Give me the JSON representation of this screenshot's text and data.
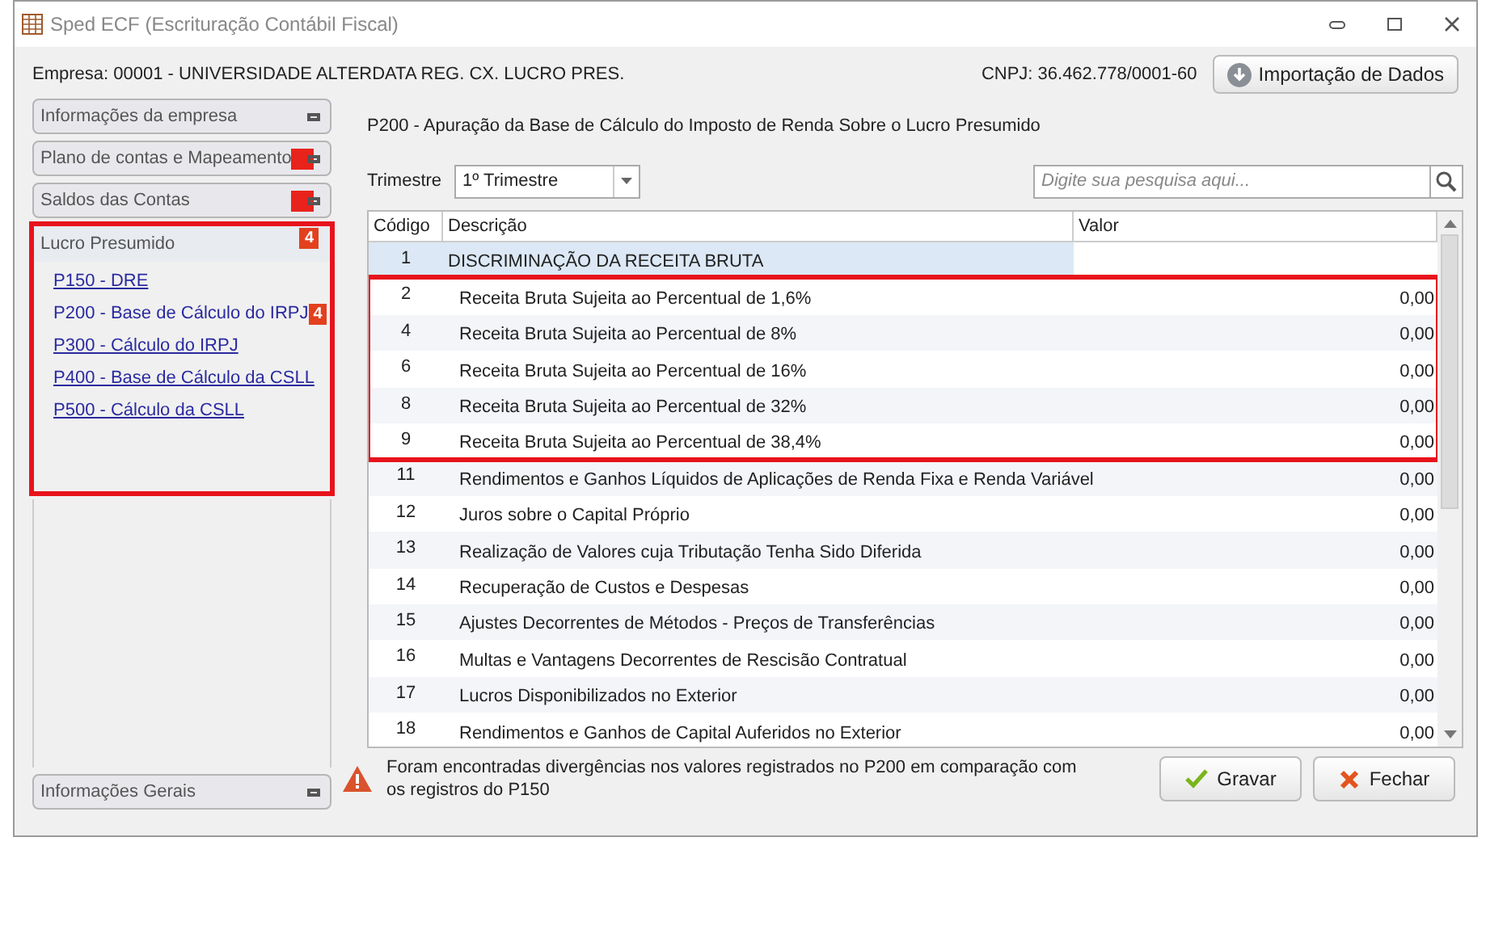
{
  "window": {
    "title": "Sped ECF (Escrituração Contábil Fiscal)"
  },
  "header": {
    "company": "Empresa: 00001 - UNIVERSIDADE ALTERDATA REG. CX. LUCRO PRES.",
    "cnpj": "CNPJ: 36.462.778/0001-60",
    "import_button": "Importação de Dados"
  },
  "sidebar": {
    "sections": [
      {
        "label": "Informações da empresa",
        "annotated": false
      },
      {
        "label": "Plano de contas e Mapeamento",
        "annotated": true
      },
      {
        "label": "Saldos das Contas",
        "annotated": true
      }
    ],
    "group": {
      "label": "Lucro Presumido",
      "badge": "4",
      "annotated": true,
      "links": [
        {
          "label": "P150 - DRE",
          "selected": false
        },
        {
          "label": "P200 - Base de Cálculo do IRPJ",
          "selected": true,
          "badge": "4"
        },
        {
          "label": "P300 - Cálculo do IRPJ",
          "selected": false
        },
        {
          "label": "P400 - Base de Cálculo da CSLL",
          "selected": false
        },
        {
          "label": "P500 - Cálculo da CSLL",
          "selected": false
        }
      ]
    },
    "footer_section": {
      "label": "Informações Gerais"
    }
  },
  "panel": {
    "title": "P200 - Apuração da Base de Cálculo do Imposto de Renda Sobre o Lucro Presumido",
    "trimestre_label": "Trimestre",
    "trimestre_value": "1º Trimestre",
    "search_placeholder": "Digite sua pesquisa aqui..."
  },
  "table": {
    "columns": [
      "Código",
      "Descrição",
      "Valor"
    ],
    "rows": [
      {
        "kind": "group",
        "code": "1",
        "description": "DISCRIMINAÇÃO DA RECEITA BRUTA",
        "annotated": false
      },
      {
        "kind": "item",
        "code": "2",
        "description": "Receita Bruta Sujeita ao Percentual de 1,6%",
        "value": "0,00",
        "annotated": true
      },
      {
        "kind": "item",
        "code": "4",
        "description": "Receita Bruta Sujeita ao Percentual de 8%",
        "value": "0,00",
        "annotated": true
      },
      {
        "kind": "item",
        "code": "6",
        "description": "Receita Bruta Sujeita ao Percentual de 16%",
        "value": "0,00",
        "annotated": true
      },
      {
        "kind": "item",
        "code": "8",
        "description": "Receita Bruta Sujeita ao Percentual de 32%",
        "value": "0,00",
        "annotated": true
      },
      {
        "kind": "item",
        "code": "9",
        "description": "Receita Bruta Sujeita ao Percentual de 38,4%",
        "value": "0,00",
        "annotated": true
      },
      {
        "kind": "item",
        "code": "11",
        "description": "Rendimentos e Ganhos Líquidos de Aplicações de Renda Fixa e Renda Variável",
        "value": "0,00",
        "annotated": false
      },
      {
        "kind": "item",
        "code": "12",
        "description": "Juros sobre o Capital Próprio",
        "value": "0,00",
        "annotated": false
      },
      {
        "kind": "item",
        "code": "13",
        "description": "Realização de Valores cuja Tributação Tenha Sido Diferida",
        "value": "0,00",
        "annotated": false
      },
      {
        "kind": "item",
        "code": "14",
        "description": "Recuperação de Custos e Despesas",
        "value": "0,00",
        "annotated": false
      },
      {
        "kind": "item",
        "code": "15",
        "description": "Ajustes Decorrentes de Métodos - Preços de Transferências",
        "value": "0,00",
        "annotated": false
      },
      {
        "kind": "item",
        "code": "16",
        "description": "Multas e Vantagens Decorrentes de Rescisão Contratual",
        "value": "0,00",
        "annotated": false
      },
      {
        "kind": "item",
        "code": "17",
        "description": "Lucros Disponibilizados no Exterior",
        "value": "0,00",
        "annotated": false
      },
      {
        "kind": "item",
        "code": "18",
        "description": "Rendimentos e Ganhos de Capital Auferidos no Exterior",
        "value": "0,00",
        "annotated": false
      }
    ]
  },
  "warning": "Foram encontradas divergências nos valores registrados no P200 em comparação com os registros do P150",
  "buttons": [
    {
      "kind": "save",
      "label": "Gravar"
    },
    {
      "kind": "close",
      "label": "Fechar"
    }
  ]
}
